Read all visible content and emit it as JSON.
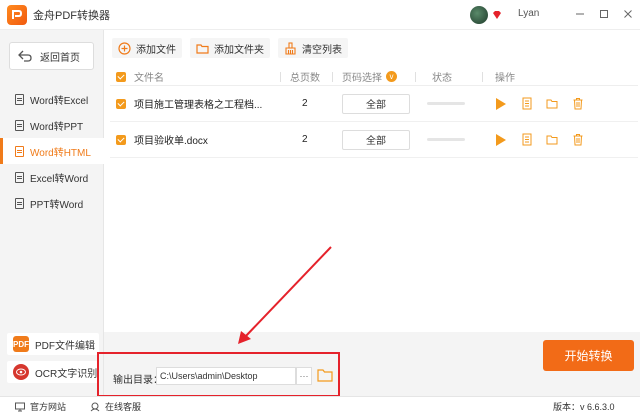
{
  "app": {
    "title": "金舟PDF转换器"
  },
  "user": {
    "name": "Lyan"
  },
  "window_controls": [
    "minimize-icon",
    "restore-icon",
    "close-icon"
  ],
  "sidebar": {
    "back_label": "返回首页",
    "items": [
      {
        "label": "Word转Excel",
        "active": false
      },
      {
        "label": "Word转PPT",
        "active": false
      },
      {
        "label": "Word转HTML",
        "active": true
      },
      {
        "label": "Excel转Word",
        "active": false
      },
      {
        "label": "PPT转Word",
        "active": false
      }
    ],
    "pdf_edit_label": "PDF文件编辑",
    "pdf_edit_icon_text": "PDF",
    "ocr_label": "OCR文字识别"
  },
  "toolbar": {
    "add_file": "添加文件",
    "add_folder": "添加文件夹",
    "clear_list": "清空列表"
  },
  "table": {
    "headers": {
      "filename": "文件名",
      "pages": "总页数",
      "page_select": "页码选择",
      "status": "状态",
      "actions": "操作"
    },
    "page_select_badge": "v",
    "rows": [
      {
        "filename": "项目施工管理表格之工程档...",
        "pages": "2",
        "range": "全部",
        "progress": 0
      },
      {
        "filename": "项目验收单.docx",
        "pages": "2",
        "range": "全部",
        "progress": 0
      }
    ]
  },
  "output": {
    "label": "输出目录：",
    "path": "C:\\Users\\admin\\Desktop",
    "browse": "···"
  },
  "start_button": "开始转换",
  "statusbar": {
    "website": "官方网站",
    "support": "在线客服",
    "version": "版本：v 6.6.3.0"
  },
  "colors": {
    "accent": "#f07b1a",
    "highlight": "#e5222b",
    "start": "#f26b17"
  }
}
